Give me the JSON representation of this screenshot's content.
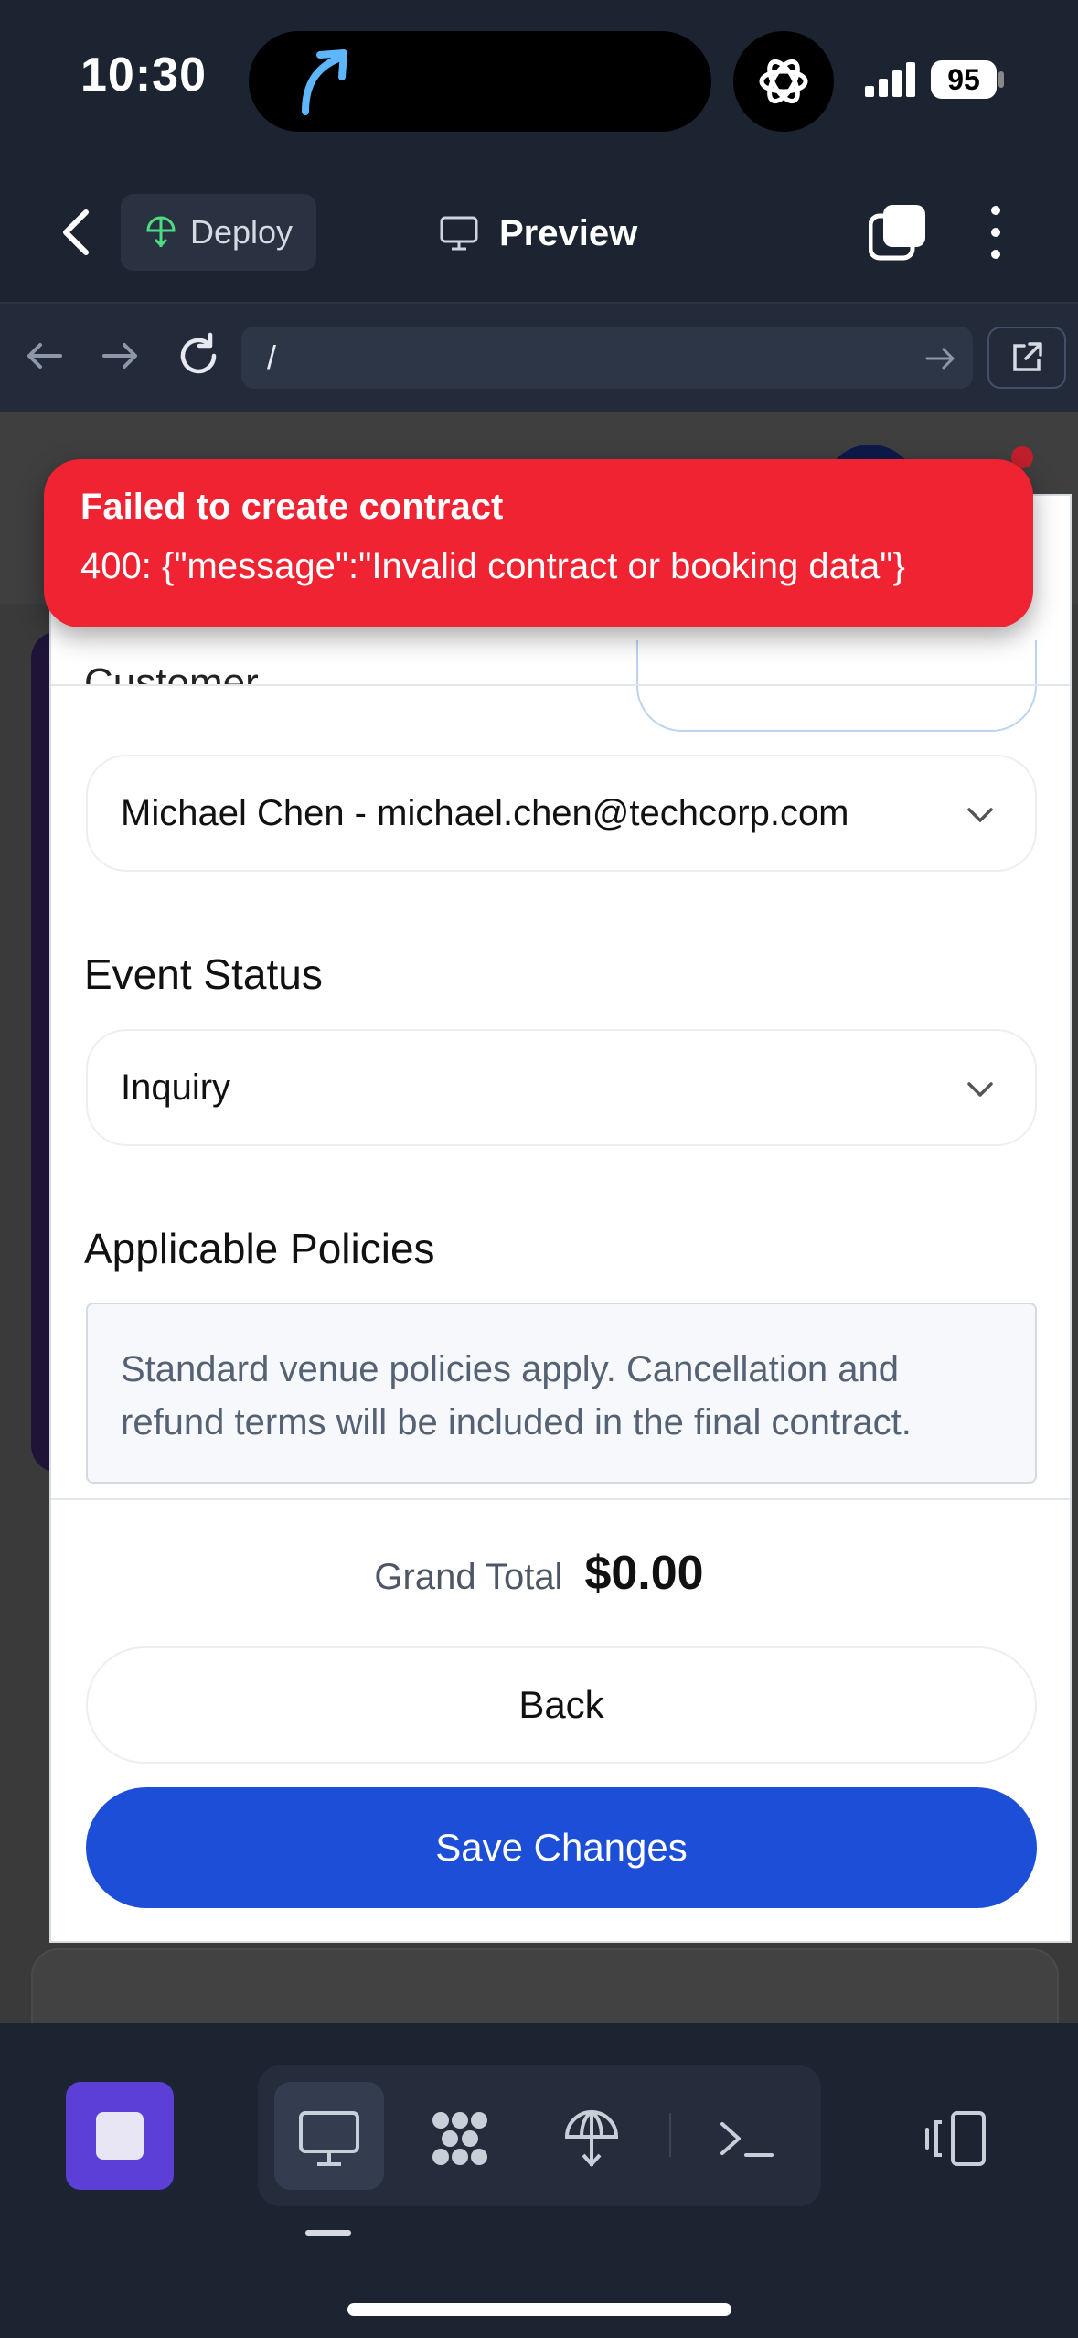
{
  "status_bar": {
    "time": "10:30",
    "battery": "95"
  },
  "header": {
    "deploy_label": "Deploy",
    "preview_label": "Preview"
  },
  "url_bar": {
    "url": "/"
  },
  "toast": {
    "title": "Failed to create contract",
    "message": "400: {\"message\":\"Invalid contract or booking data\"}"
  },
  "form": {
    "customer_label_partial": "Customer",
    "customer_value": "Michael Chen - michael.chen@techcorp.com",
    "event_status_label": "Event Status",
    "event_status_value": "Inquiry",
    "policies_label": "Applicable Policies",
    "policies_text": "Standard venue policies apply. Cancellation and refund terms will be included in the final contract."
  },
  "footer": {
    "grand_total_label": "Grand Total",
    "grand_total_value": "$0.00",
    "back_label": "Back",
    "save_label": "Save Changes"
  },
  "colors": {
    "accent": "#1d4ed8",
    "error": "#ef2332",
    "stop": "#5b3fd6"
  }
}
